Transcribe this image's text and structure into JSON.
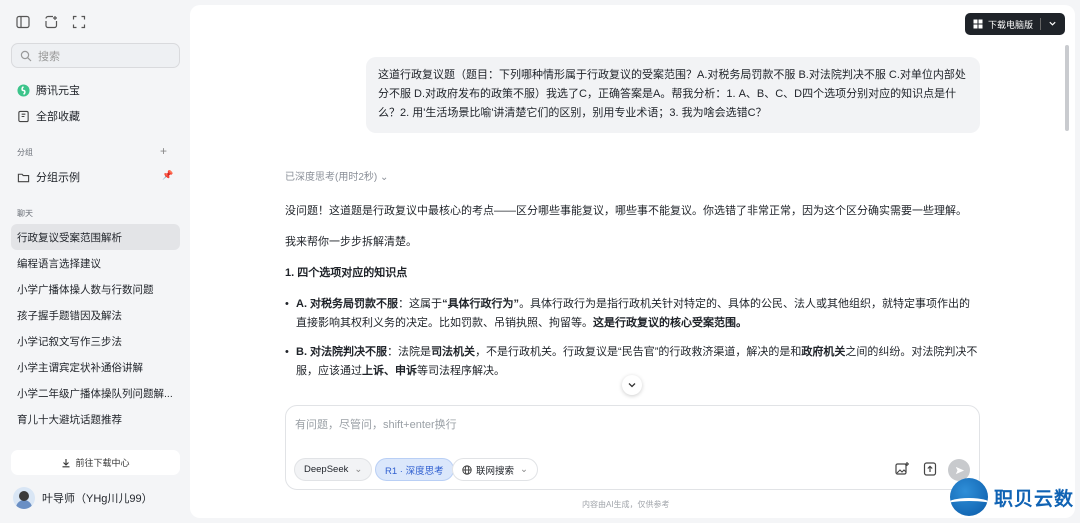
{
  "sidebar": {
    "search_placeholder": "搜索",
    "nav": [
      {
        "label": "腾讯元宝"
      },
      {
        "label": "全部收藏"
      }
    ],
    "groups_heading": "分组",
    "group_example": "分组示例",
    "chats_heading": "聊天",
    "chats": [
      {
        "label": "行政复议受案范围解析",
        "active": true
      },
      {
        "label": "编程语言选择建议"
      },
      {
        "label": "小学广播体操人数与行数问题"
      },
      {
        "label": "孩子握手题错因及解法"
      },
      {
        "label": "小学记叙文写作三步法"
      },
      {
        "label": "小学主谓宾定状补通俗讲解"
      },
      {
        "label": "小学二年级广播体操队列问题解..."
      },
      {
        "label": "育儿十大避坑话题推荐"
      }
    ],
    "download_center": "前往下载中心",
    "user_name": "叶导师（YHg川儿99）"
  },
  "header": {
    "download_pc": "下载电脑版"
  },
  "user_message": "这道行政复议题（题目：下列哪种情形属于行政复议的受案范围？A.对税务局罚款不服 B.对法院判决不服 C.对单位内部处分不服 D.对政府发布的政策不服）我选了C，正确答案是A。帮我分析：1. A、B、C、D四个选项分别对应的知识点是什么？2. 用'生活场景比喻'讲清楚它们的区别，别用专业术语；3. 我为啥会选错C？",
  "thinking_label": "已深度思考(用时2秒)",
  "answer": {
    "p1": "没问题！这道题是行政复议中最核心的考点——区分哪些事能复议，哪些事不能复议。你选错了非常正常，因为这个区分确实需要一些理解。",
    "p2": "我来帮你一步步拆解清楚。",
    "heading": "1. 四个选项对应的知识点",
    "itemA": {
      "title": "A. 对税务局罚款不服",
      "t1": "：这属于",
      "b1": "“具体行政行为”",
      "t2": "。具体行政行为是指行政机关针对特定的、具体的公民、法人或其他组织，就特定事项作出的直接影响其权利义务的决定。比如罚款、吊销执照、拘留等。",
      "b2": "这是行政复议的核心受案范围。"
    },
    "itemB": {
      "title": "B. 对法院判决不服",
      "t1": "：法院是",
      "b1": "司法机关",
      "t2": "，不是行政机关。行政复议是“民告官”的行政救济渠道，解决的是和",
      "b2": "政府机关",
      "t3": "之间的纠纷。对法院判决不服，应该通过",
      "b3": "上诉、申诉",
      "t4": "等司法程序解决。"
    }
  },
  "input": {
    "placeholder": "有问题，尽管问，shift+enter换行",
    "model": "DeepSeek",
    "deep_think": "R1 · 深度思考",
    "web_search": "联网搜索"
  },
  "footer": "内容由AI生成，仅供参考",
  "watermark": "职贝云数",
  "colors": {
    "accent": "#2f5fd0",
    "dark_button": "#1f2329",
    "brand": "#1063b4"
  }
}
